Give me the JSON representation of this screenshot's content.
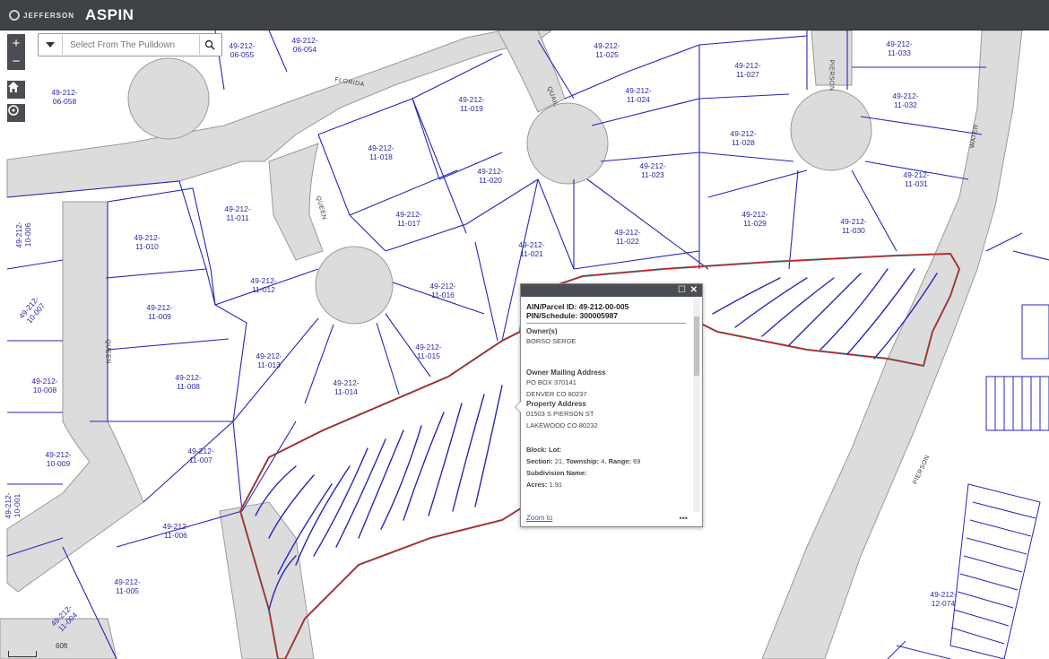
{
  "header": {
    "logo_text": "JEFFERSON",
    "app_title": "ASPIN"
  },
  "toolbar": {
    "zoom_in_label": "+",
    "zoom_out_label": "−",
    "home_icon": "home-icon",
    "locate_icon": "locate-icon"
  },
  "search": {
    "placeholder": "Select From The Pulldown",
    "dropdown_icon": "caret-down-icon",
    "search_icon": "search-icon"
  },
  "colors": {
    "header_bg": "#3f4247",
    "road_fill": "#dcdcdc",
    "parcel_line": "#2626b8",
    "label_text": "#2a2aa8",
    "highlight_red": "#d01c1c",
    "highlight_cyan": "#22cccc"
  },
  "parcels": [
    "49-212-06-054",
    "49-212-06-055",
    "49-212-06-058",
    "49-212-11-025",
    "49-212-11-027",
    "49-212-11-033",
    "49-212-11-019",
    "49-212-11-024",
    "49-212-11-032",
    "49-212-11-028",
    "49-212-11-018",
    "49-212-11-020",
    "49-212-11-023",
    "49-212-11-031",
    "49-212-11-011",
    "49-212-11-017",
    "49-212-11-029",
    "49-212-11-030",
    "49-212-10-006",
    "49-212-11-010",
    "49-212-11-021",
    "49-212-11-022",
    "49-212-11-012",
    "49-212-11-016",
    "49-212-10-007",
    "49-212-11-009",
    "49-212-11-015",
    "49-212-11-013",
    "49-212-10-008",
    "49-212-11-008",
    "49-212-11-014",
    "49-212-11-007",
    "49-212-10-009",
    "49-212-10-001",
    "49-212-11-006",
    "49-212-11-005",
    "49-212-11-004",
    "49-212-12-074"
  ],
  "streets": [
    "FLORIDA",
    "QUAIL",
    "PIERSON",
    "WATER",
    "QUEEN",
    "QUEEN",
    "PIERSON"
  ],
  "popup": {
    "ain_label": "AIN/Parcel ID:",
    "ain_value": "49-212-00-005",
    "pin_label": "PIN/Schedule:",
    "pin_value": "300005987",
    "owner_heading": "Owner(s)",
    "owner_name": "BORSO SERGE",
    "mailing_heading": "Owner Mailing Address",
    "mailing_line1": "PO BOX 370141",
    "mailing_line2": "DENVER CO 80237",
    "property_heading": "Property Address",
    "property_line1": "01503 S PIERSON ST",
    "property_line2": "LAKEWOOD CO 80232",
    "block_label": "Block:",
    "lot_label": "Lot:",
    "section_label": "Section:",
    "section_value": "21",
    "township_label": "Township:",
    "township_value": "4",
    "range_label": "Range:",
    "range_value": "69",
    "subdivision_label": "Subdivision Name:",
    "acres_label": "Acres:",
    "acres_value": "1.91",
    "zoom_link": "Zoom to",
    "more_icon": "ellipsis-icon",
    "maximize_icon": "maximize-icon",
    "close_icon": "close-icon"
  },
  "scale": {
    "label": "60ft"
  }
}
